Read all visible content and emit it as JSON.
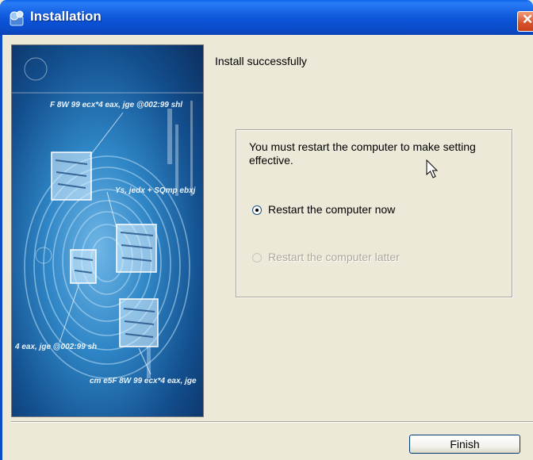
{
  "window": {
    "title": "Installation",
    "close_label": "✕"
  },
  "main": {
    "status": "Install successfully",
    "message": "You must restart the computer to make setting effective.",
    "options": [
      {
        "label": "Restart the computer now",
        "selected": true,
        "enabled": true
      },
      {
        "label": "Restart the computer latter",
        "selected": false,
        "enabled": false
      }
    ]
  },
  "art_labels": [
    "F 8W 99 ecx*4 eax, jge @002:99 shl",
    "Ys, jedx + SQmp ebxj",
    "4 eax, jge @002:99 sh",
    "cm e5F 8W 99 ecx*4 eax, jge"
  ],
  "footer": {
    "finish_label": "Finish"
  },
  "colors": {
    "titlebar": "#0b52d6",
    "client_bg": "#ece9d8",
    "button_border": "#003c74",
    "close_red": "#d5512c"
  }
}
